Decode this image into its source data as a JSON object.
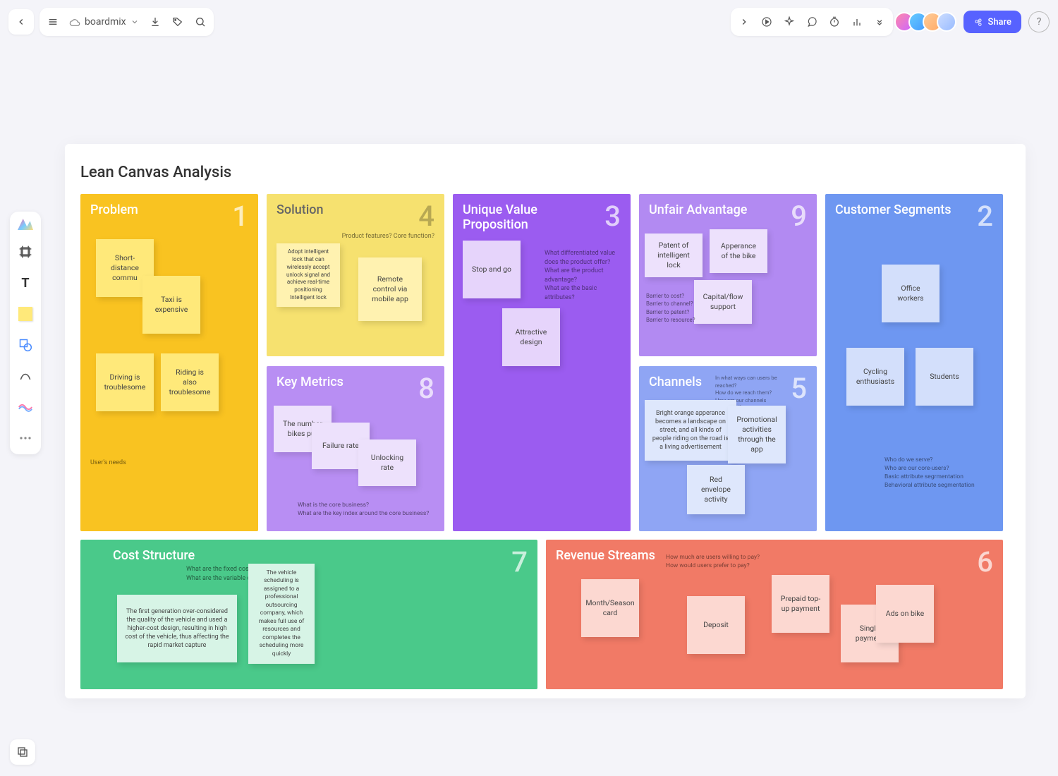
{
  "app": {
    "name": "boardmix",
    "share_label": "Share"
  },
  "canvas": {
    "title": "Lean Canvas Analysis"
  },
  "blocks": {
    "problem": {
      "title": "Problem",
      "num": "1",
      "hint": "User's needs",
      "notes": [
        "Short-distance commu",
        "Taxi is expensive",
        "Driving is troublesome",
        "Riding is also troublesome"
      ]
    },
    "solution": {
      "title": "Solution",
      "num": "4",
      "hint": "Product features? Core function?",
      "notes": [
        "Adopt intelligent lock that can wirelessly accept unlock signal and achieve real-time positioning Intelligent lock",
        "Remote control via mobile app"
      ]
    },
    "uvp": {
      "title": "Unique Value Proposition",
      "num": "3",
      "hint": "What differentiated value does the product offer?\nWhat are the product advantage?\nWhat are the basic attributes?",
      "notes": [
        "Stop and go",
        "Attractive design"
      ]
    },
    "unfair": {
      "title": "Unfair Advantage",
      "num": "9",
      "hint": "Barrier to cost?\nBarrier to channel?\nBarrier to patent?\nBarrier to resource?",
      "notes": [
        "Patent of intelligent lock",
        "Apperance of the bike",
        "Capital/flow support"
      ]
    },
    "segments": {
      "title": "Customer Segments",
      "num": "2",
      "hint": "Who do we serve?\nWho are our core-users?\nBasic attribute segrmentation\nBehavioral attribute segmentation",
      "notes": [
        "Office workers",
        "Cycling enthusiasts",
        "Students"
      ]
    },
    "metrics": {
      "title": "Key Metrics",
      "num": "8",
      "hint": "What is the core business?\nWhat are the key index around the core business?",
      "notes": [
        "The number bikes put",
        "Failure rate",
        "Unlocking rate"
      ]
    },
    "channels": {
      "title": "Channels",
      "num": "5",
      "hint": "In what ways can users be reached?\nHow do we reach them?\nHow are our channels integrated?",
      "notes": [
        "Bright orange apperance becomes a landscape on street, and all kinds of people riding on the road is a living advertisement",
        "Promotional activities through the app",
        "Red envelope activity"
      ]
    },
    "cost": {
      "title": "Cost Structure",
      "num": "7",
      "hint": "What are the fixed costs?\nWhat are the variable costs?",
      "notes": [
        "The first generation over-considered the quality of the vehicle and used a higher-cost design, resulting in high cost of the vehicle, thus affecting the rapid market capture",
        "The vehicle scheduling is assigned to a professional outsourcing company, which makes full use of resources and completes the scheduling more quickly"
      ]
    },
    "revenue": {
      "title": "Revenue Streams",
      "num": "6",
      "hint": "How much are users willing to pay?\nHow would users prefer to pay?",
      "notes": [
        "Month/Season card",
        "Deposit",
        "Prepaid top-up payment",
        "Single payment",
        "Ads on bike"
      ]
    }
  }
}
